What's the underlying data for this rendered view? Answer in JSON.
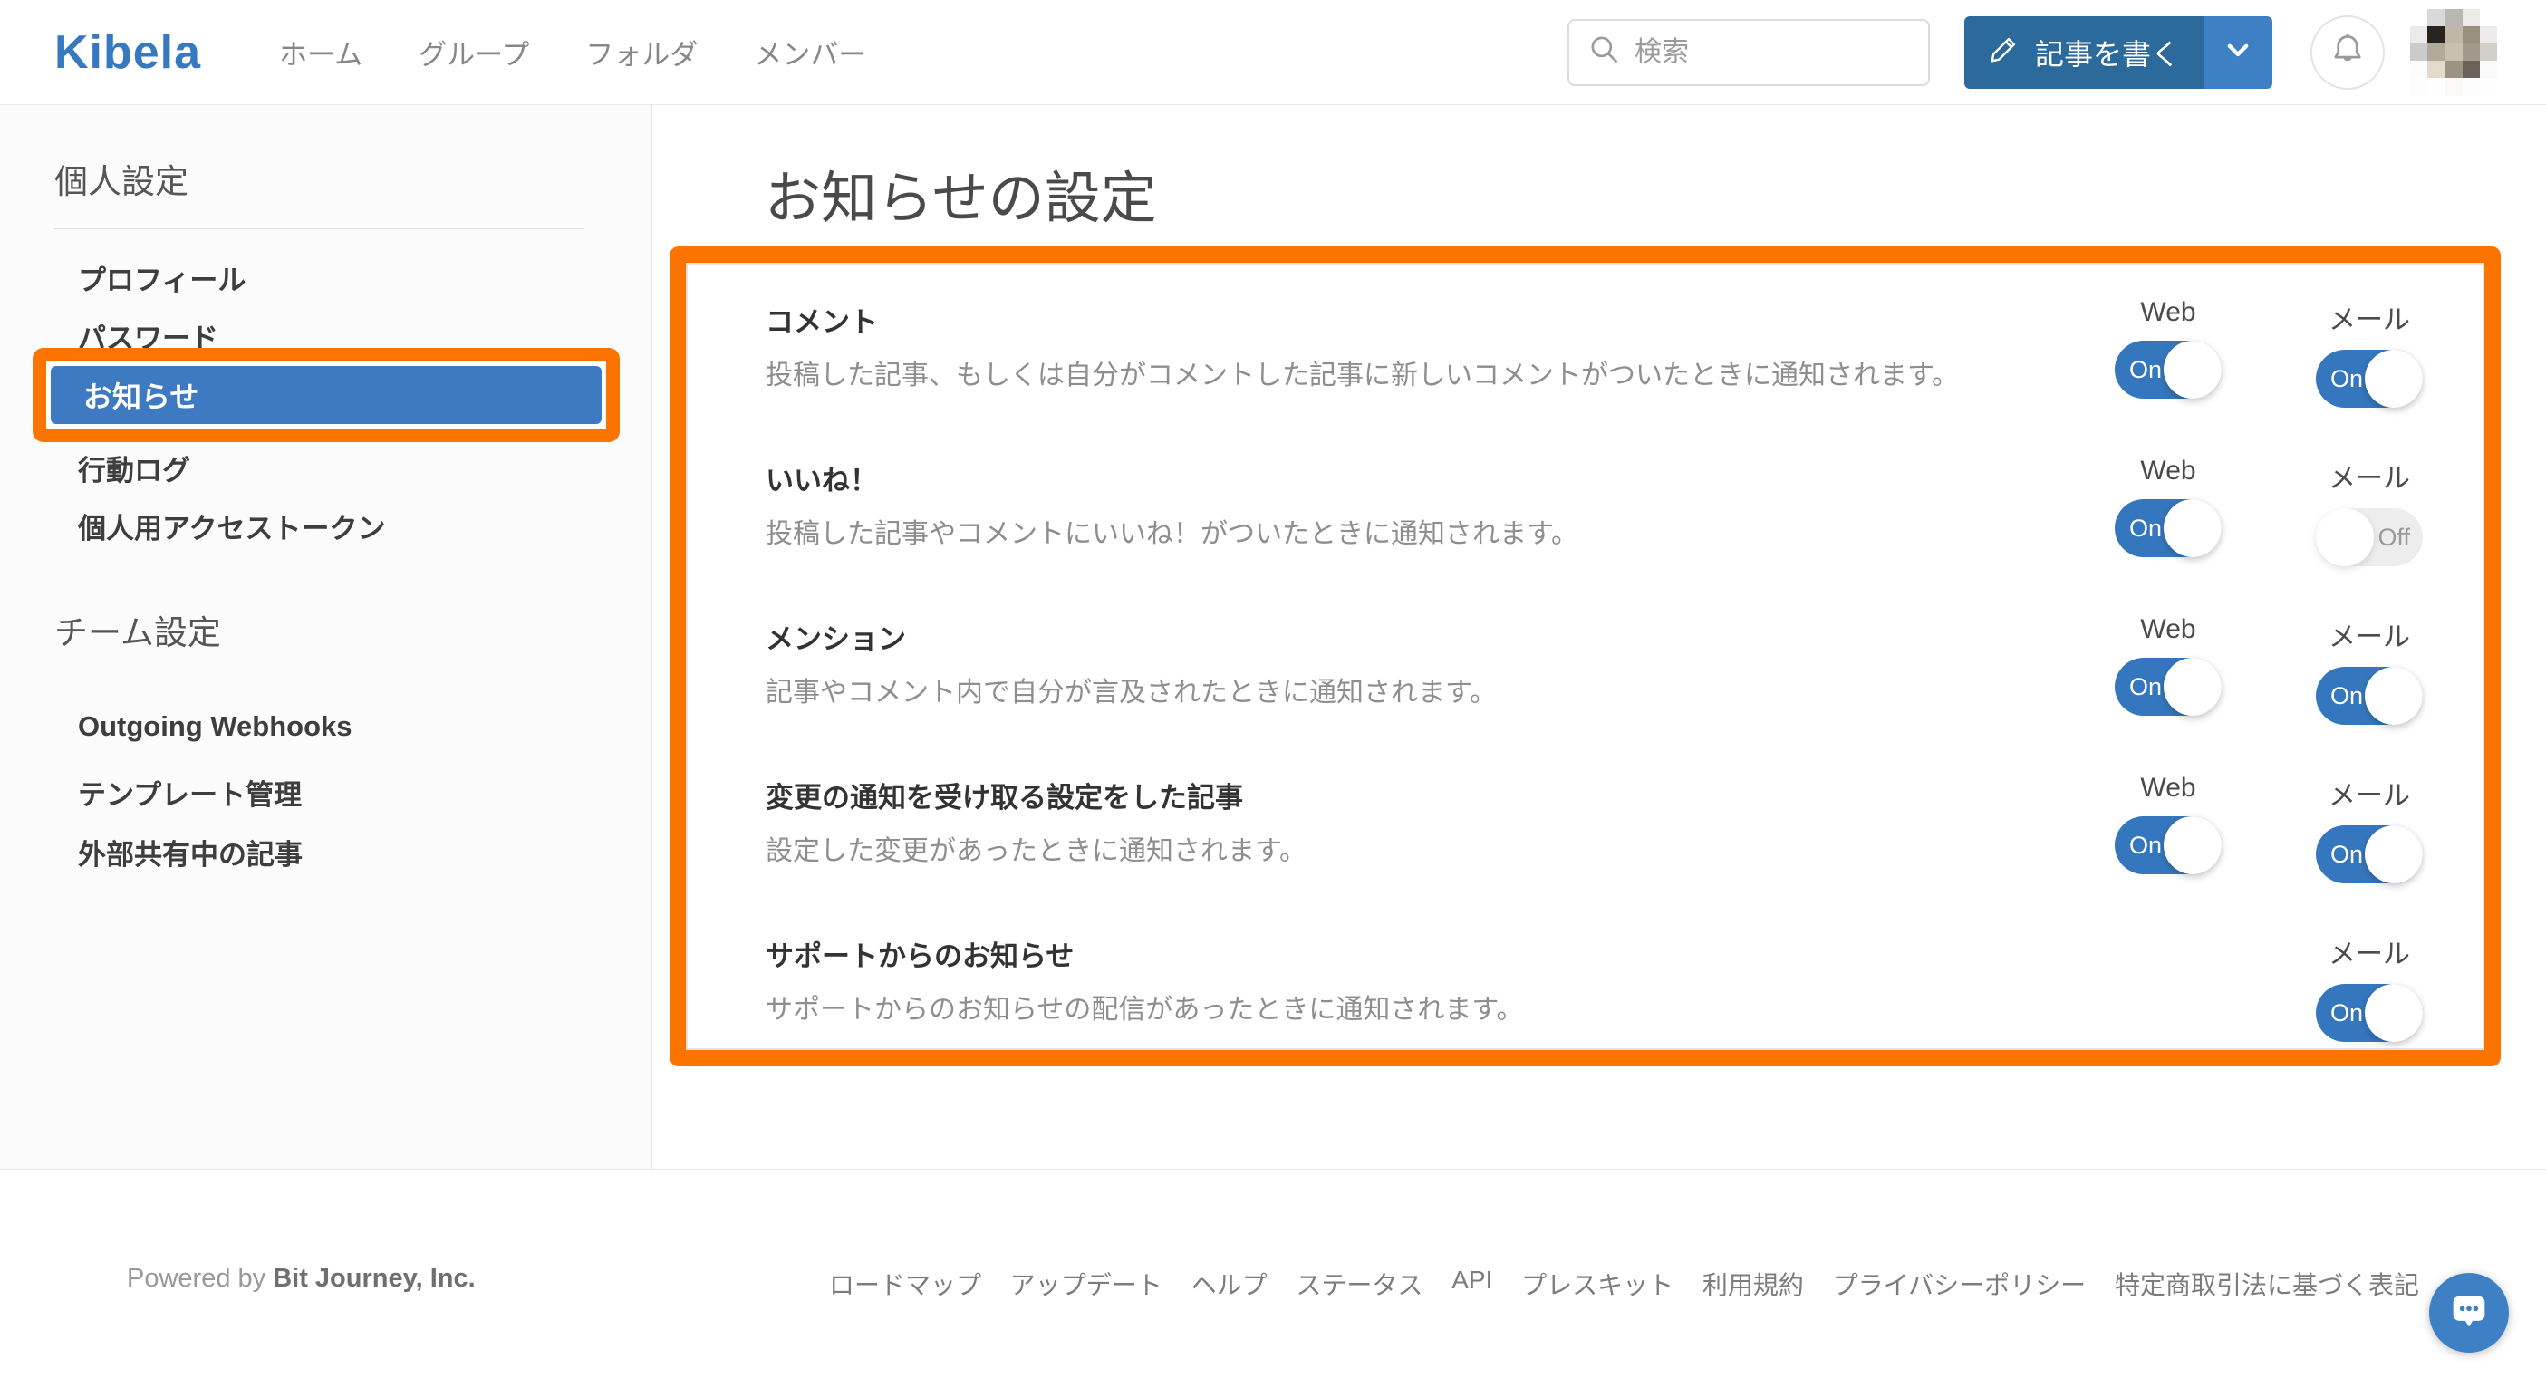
{
  "navbar": {
    "logo": "Kibela",
    "links": [
      "ホーム",
      "グループ",
      "フォルダ",
      "メンバー"
    ],
    "search_placeholder": "検索",
    "write_button_label": "記事を書く"
  },
  "sidebar": {
    "personal": {
      "title": "個人設定",
      "items": [
        "プロフィール",
        "パスワード",
        "お知らせ",
        "行動ログ",
        "個人用アクセストークン"
      ],
      "selected": "お知らせ"
    },
    "team": {
      "title": "チーム設定",
      "items": [
        "Outgoing Webhooks",
        "テンプレート管理",
        "外部共有中の記事"
      ]
    }
  },
  "main": {
    "title": "お知らせの設定",
    "columns": {
      "web": "Web",
      "mail": "メール"
    },
    "toggle_on_label": "On",
    "toggle_off_label": "Off",
    "rows": [
      {
        "title": "コメント",
        "description": "投稿した記事、もしくは自分がコメントした記事に新しいコメントがついたときに通知されます。",
        "web": "On",
        "mail": "On"
      },
      {
        "title": "いいね！",
        "description": "投稿した記事やコメントにいいね！がついたときに通知されます。",
        "web": "On",
        "mail": "Off"
      },
      {
        "title": "メンション",
        "description": "記事やコメント内で自分が言及されたときに通知されます。",
        "web": "On",
        "mail": "On"
      },
      {
        "title": "変更の通知を受け取る設定をした記事",
        "description": "設定した変更があったときに通知されます。",
        "web": "On",
        "mail": "On"
      },
      {
        "title": "サポートからのお知らせ",
        "description": "サポートからのお知らせの配信があったときに通知されます。",
        "web": null,
        "mail": "On"
      }
    ]
  },
  "footer": {
    "powered_prefix": "Powered by ",
    "powered_company": "Bit Journey, Inc.",
    "links": [
      "ロードマップ",
      "アップデート",
      "ヘルプ",
      "ステータス",
      "API",
      "プレスキット",
      "利用規約",
      "プライバシーポリシー",
      "特定商取引法に基づく表記"
    ]
  },
  "colors": {
    "annotation_orange": "#fb7400",
    "brand_blue": "#3779c1",
    "btn_primary": "#2d6a9c",
    "btn_caret": "#3e80c4",
    "toggle_on": "#3577be",
    "selected_blue": "#3d7ac1"
  },
  "avatar_mosaic": [
    "#ffffff",
    "#d9d9d7",
    "#bab8b3",
    "#ebeae7",
    "#ffffff",
    "#eaeaea",
    "#27241f",
    "#c0b8a6",
    "#979081",
    "#edecea",
    "#cbcbcb",
    "#b0aa9a",
    "#c9c1ad",
    "#a2998a",
    "#d2cfc9",
    "#fcfcfc",
    "#e2dbcd",
    "#9b9383",
    "#6a6158",
    "#fafafa",
    "#fdfdfd",
    "#fefefe",
    "#faf9f6",
    "#fdfdfd",
    "#fefefe"
  ]
}
